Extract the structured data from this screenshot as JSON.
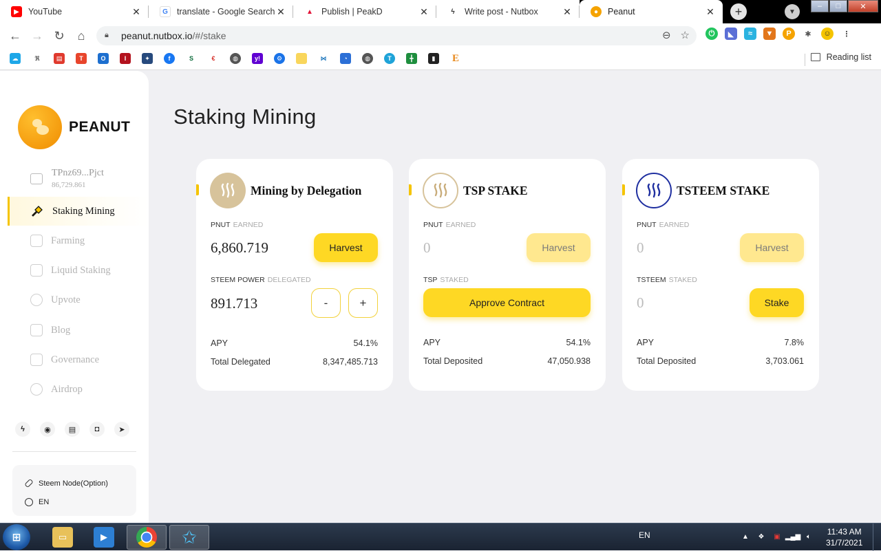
{
  "browser": {
    "tabs": [
      {
        "title": "YouTube",
        "favicon": "youtube-icon",
        "color": "#ff0000",
        "state": "inactive"
      },
      {
        "title": "translate - Google Search",
        "favicon": "google-icon",
        "color": "#4285f4",
        "state": "inactive"
      },
      {
        "title": "Publish | PeakD",
        "favicon": "peakd-icon",
        "color": "#e31337",
        "state": "inactive"
      },
      {
        "title": "Write post - Nutbox",
        "favicon": "nutbox-bolt-icon",
        "color": "#333333",
        "state": "inactive"
      },
      {
        "title": "Peanut",
        "favicon": "peanut-icon",
        "color": "#f5a300",
        "state": "active"
      }
    ],
    "address": {
      "host": "peanut.nutbox.io",
      "path": "/#/stake"
    },
    "bookmarks_right": "Reading list"
  },
  "app": {
    "brand": "PEANUT",
    "wallet": {
      "address": "TPnz69...Pjct",
      "balance": "86,729.861"
    },
    "nav": [
      {
        "label": "Staking Mining",
        "icon": "staking-icon",
        "active": true
      },
      {
        "label": "Farming",
        "icon": "farming-icon",
        "active": false
      },
      {
        "label": "Liquid Staking",
        "icon": "liquid-staking-icon",
        "active": false
      },
      {
        "label": "Upvote",
        "icon": "upvote-icon",
        "active": false
      },
      {
        "label": "Blog",
        "icon": "blog-icon",
        "active": false
      },
      {
        "label": "Governance",
        "icon": "governance-icon",
        "active": false
      },
      {
        "label": "Airdrop",
        "icon": "airdrop-icon",
        "active": false
      }
    ],
    "social": [
      "steem-icon",
      "github-icon",
      "docs-icon",
      "discord-icon",
      "telegram-icon"
    ],
    "settings": {
      "node": "Steem Node(Option)",
      "lang": "EN"
    },
    "page_title": "Staking Mining",
    "accent_color": "#fed824",
    "cards": [
      {
        "title": "Mining by Delegation",
        "earned_token": "PNUT",
        "earned_label": "EARNED",
        "earned_value": "6,860.719",
        "harvest_label": "Harvest",
        "stake_token": "STEEM POWER",
        "stake_label": "DELEGATED",
        "stake_value": "891.713",
        "minus_label": "-",
        "plus_label": "+",
        "apy_label": "APY",
        "apy_value": "54.1%",
        "total_label": "Total Delegated",
        "total_value": "8,347,485.713"
      },
      {
        "title": "TSP STAKE",
        "earned_token": "PNUT",
        "earned_label": "EARNED",
        "earned_value": "0",
        "harvest_label": "Harvest",
        "stake_token": "TSP",
        "stake_label": "STAKED",
        "approve_label": "Approve Contract",
        "apy_label": "APY",
        "apy_value": "54.1%",
        "total_label": "Total Deposited",
        "total_value": "47,050.938"
      },
      {
        "title": "TSTEEM STAKE",
        "earned_token": "PNUT",
        "earned_label": "EARNED",
        "earned_value": "0",
        "harvest_label": "Harvest",
        "stake_token": "TSTEEM",
        "stake_label": "STAKED",
        "stake_value": "0",
        "stake_button": "Stake",
        "apy_label": "APY",
        "apy_value": "7.8%",
        "total_label": "Total Deposited",
        "total_value": "3,703.061"
      }
    ]
  },
  "taskbar": {
    "lang": "EN",
    "time": "11:43 AM",
    "date": "31/7/2021"
  }
}
